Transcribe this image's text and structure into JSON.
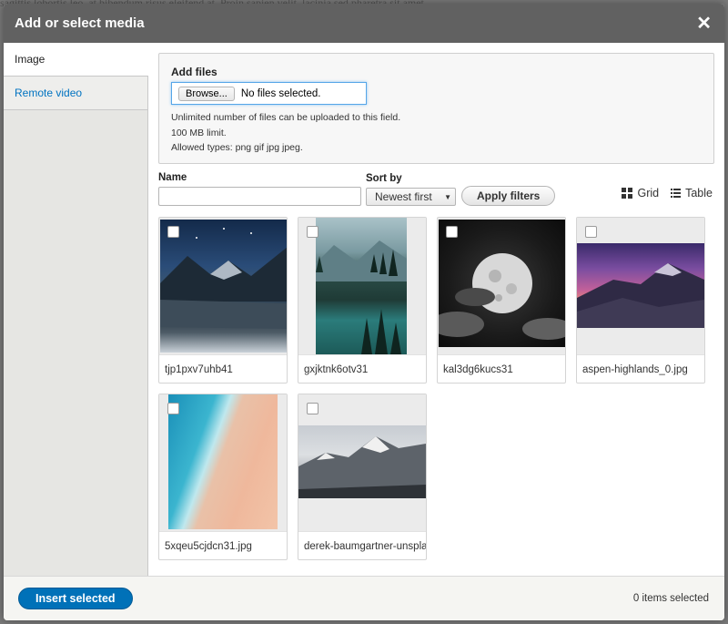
{
  "dialog": {
    "title": "Add or select media",
    "close_icon": "close-icon"
  },
  "background_text": "sagittis lobortis leo, at bibendum risus eleifend at. Proin sapien velit, lacinia sed pharetra sit amet,",
  "tabs": [
    {
      "label": "Image",
      "active": true
    },
    {
      "label": "Remote video",
      "active": false
    }
  ],
  "add_files": {
    "label": "Add files",
    "browse_label": "Browse...",
    "file_status": "No files selected.",
    "help": [
      "Unlimited number of files can be uploaded to this field.",
      "100 MB limit.",
      "Allowed types: png gif jpg jpeg."
    ]
  },
  "filters": {
    "name_label": "Name",
    "name_value": "",
    "sort_label": "Sort by",
    "sort_value": "Newest first",
    "apply_label": "Apply filters",
    "grid_label": "Grid",
    "table_label": "Table"
  },
  "media": [
    {
      "label": "tjp1pxv7uhb41",
      "checked": false
    },
    {
      "label": "gxjktnk6otv31",
      "checked": false
    },
    {
      "label": "kal3dg6kucs31",
      "checked": false
    },
    {
      "label": "aspen-highlands_0.jpg",
      "checked": false
    },
    {
      "label": "5xqeu5cjdcn31.jpg",
      "checked": false
    },
    {
      "label": "derek-baumgartner-unsplash.jpg",
      "checked": false
    }
  ],
  "footer": {
    "insert_label": "Insert selected",
    "selected_count": "0 items selected"
  },
  "colors": {
    "titlebar": "#616161",
    "accent": "#0071b8",
    "link": "#0073c1"
  }
}
